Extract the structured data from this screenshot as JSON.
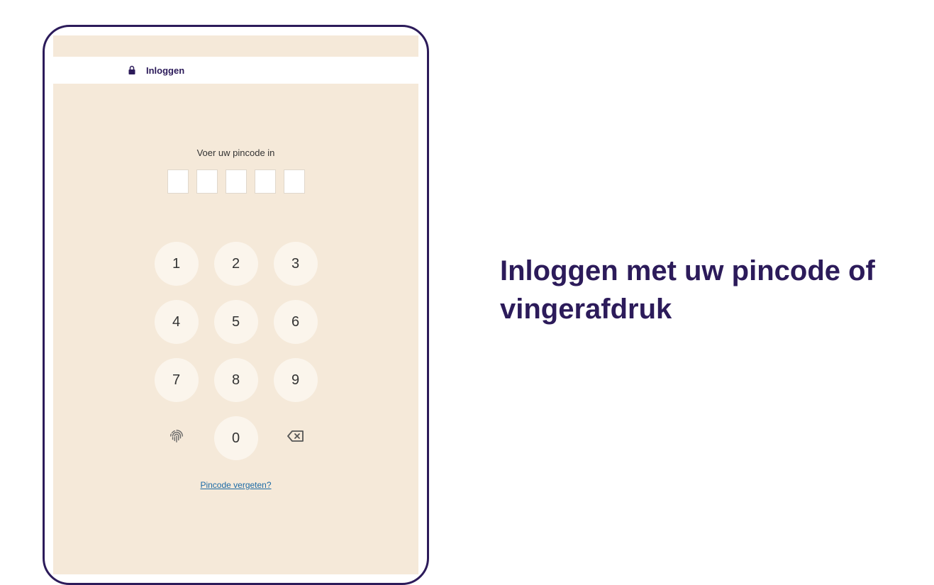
{
  "header": {
    "title": "Inloggen"
  },
  "pin": {
    "prompt": "Voer uw pincode in",
    "forgot_link": "Pincode vergeten?"
  },
  "keypad": {
    "k1": "1",
    "k2": "2",
    "k3": "3",
    "k4": "4",
    "k5": "5",
    "k6": "6",
    "k7": "7",
    "k8": "8",
    "k9": "9",
    "k0": "0"
  },
  "marketing": {
    "heading": "Inloggen met uw pincode of vingerafdruk"
  }
}
